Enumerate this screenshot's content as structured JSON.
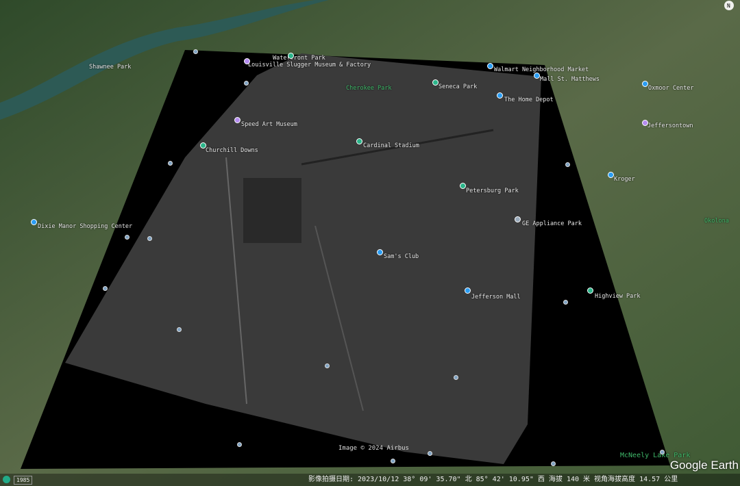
{
  "labels": [
    {
      "text": "Louisville Slugger Museum & Factory",
      "type": "w"
    },
    {
      "text": "Waterfront Park",
      "type": "w"
    },
    {
      "text": "Shawnee Park",
      "type": "w"
    },
    {
      "text": "Cherokee Park",
      "type": "g"
    },
    {
      "text": "Seneca Park",
      "type": "w"
    },
    {
      "text": "Walmart Neighborhood Market",
      "type": "w"
    },
    {
      "text": "Mall St. Matthews",
      "type": "w"
    },
    {
      "text": "The Home Depot",
      "type": "w"
    },
    {
      "text": "Oxmoor Center",
      "type": "w"
    },
    {
      "text": "Speed Art Museum",
      "type": "w"
    },
    {
      "text": "Churchill Downs",
      "type": "w"
    },
    {
      "text": "Cardinal Stadium",
      "type": "w"
    },
    {
      "text": "Petersburg Park",
      "type": "w"
    },
    {
      "text": "GE Appliance Park",
      "type": "w"
    },
    {
      "text": "Sam's Club",
      "type": "w"
    },
    {
      "text": "Jefferson Mall",
      "type": "w"
    },
    {
      "text": "Highview Park",
      "type": "w"
    },
    {
      "text": "Dixie Manor Shopping Center",
      "type": "w"
    },
    {
      "text": "Kroger",
      "type": "w"
    },
    {
      "text": "Jeffersontown",
      "type": "w"
    },
    {
      "text": "Okolona",
      "type": "g"
    },
    {
      "text": "McNeely Lake Park",
      "type": "g"
    }
  ],
  "image_credit": "Image © 2024 Airbus",
  "logo": "Google Earth",
  "compass": "N",
  "status": {
    "year": "1985",
    "coords": "影像拍摄日期: 2023/10/12   38° 09' 35.70\" 北  85° 42' 10.95\" 西  海拔  140 米   视角海拔高度  14.57 公里"
  }
}
